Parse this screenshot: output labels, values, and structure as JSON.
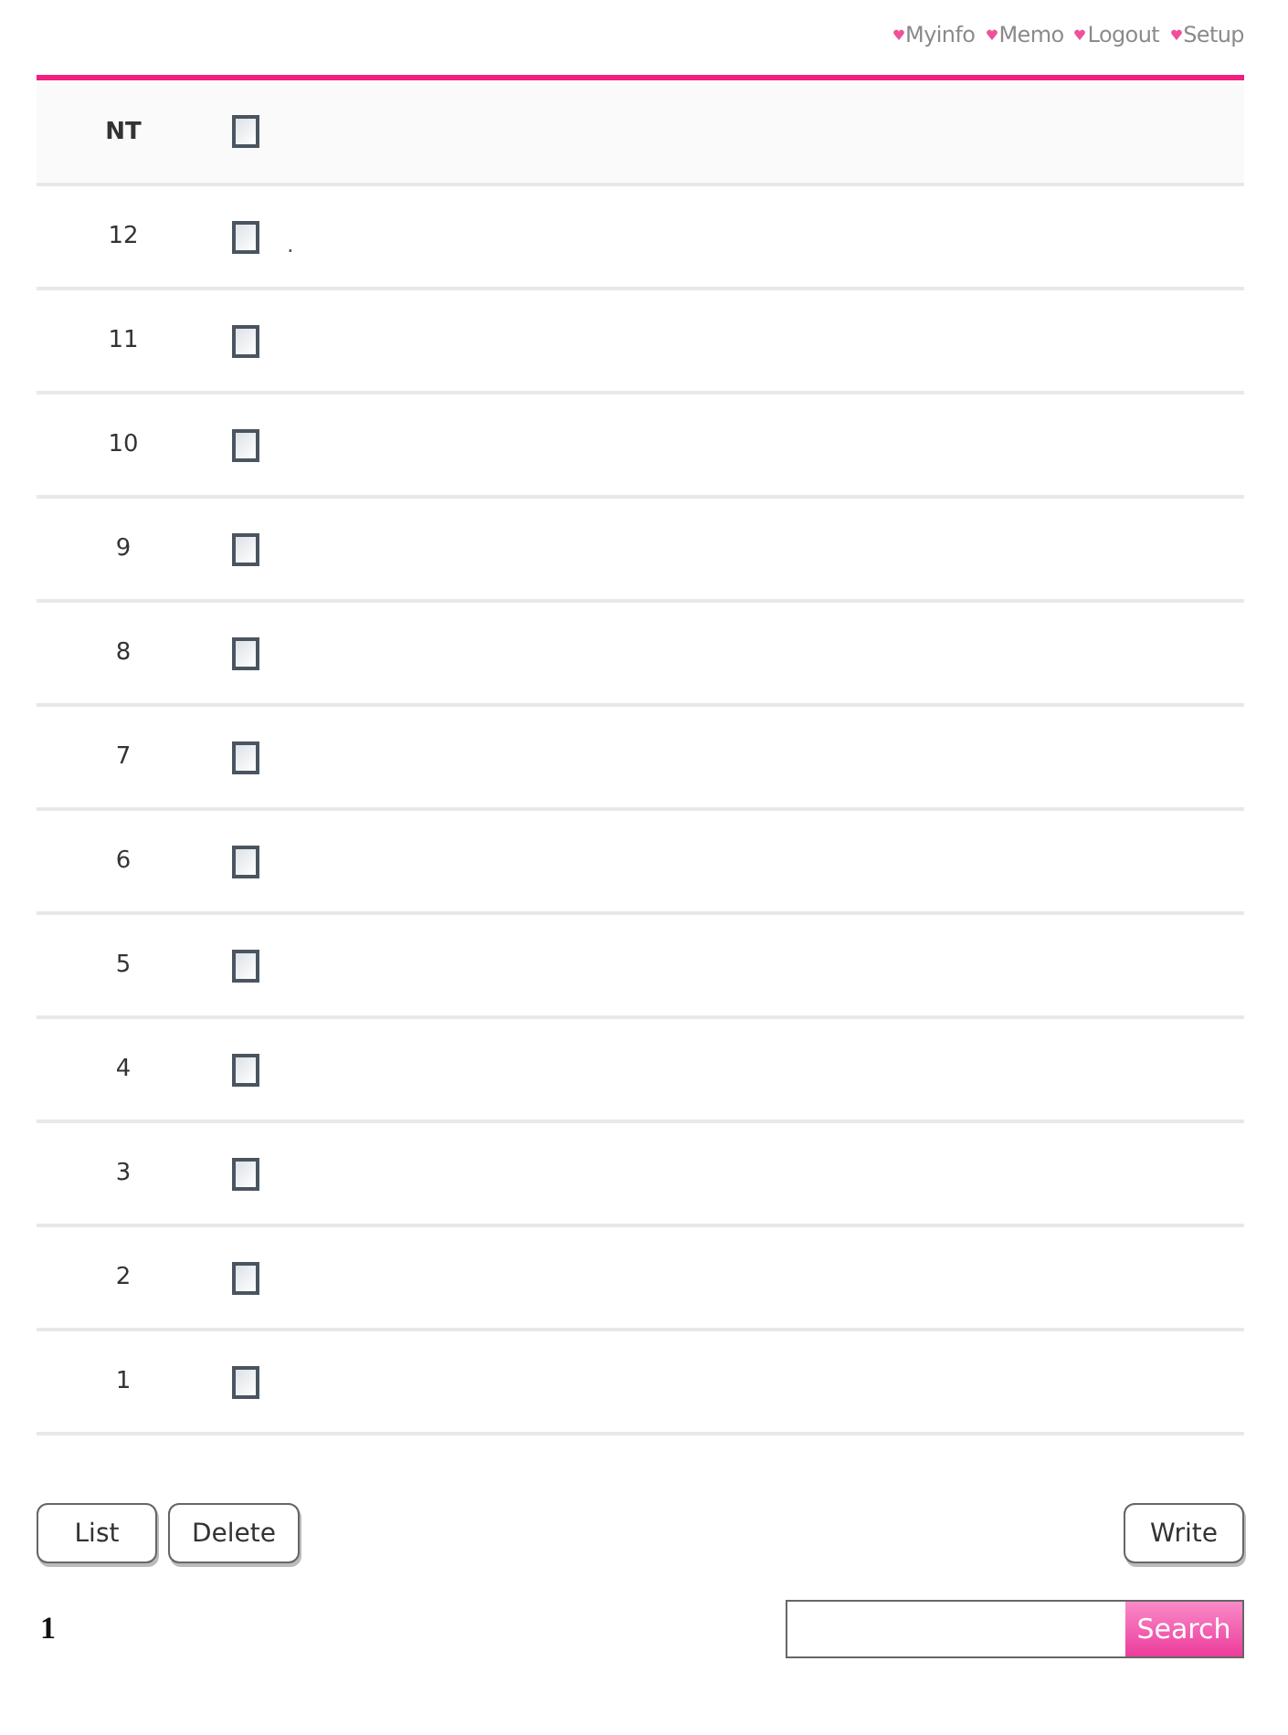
{
  "top_links": [
    {
      "label": "Myinfo"
    },
    {
      "label": "Memo"
    },
    {
      "label": "Logout"
    },
    {
      "label": "Setup"
    }
  ],
  "table": {
    "header": {
      "label": "NT",
      "checked": false
    },
    "rows": [
      {
        "number": "12",
        "checked": false,
        "title": "."
      },
      {
        "number": "11",
        "checked": false
      },
      {
        "number": "10",
        "checked": false
      },
      {
        "number": "9",
        "checked": false
      },
      {
        "number": "8",
        "checked": false
      },
      {
        "number": "7",
        "checked": false
      },
      {
        "number": "6",
        "checked": false
      },
      {
        "number": "5",
        "checked": false
      },
      {
        "number": "4",
        "checked": false
      },
      {
        "number": "3",
        "checked": false
      },
      {
        "number": "2",
        "checked": false
      },
      {
        "number": "1",
        "checked": false
      }
    ]
  },
  "buttons_left": [
    "List",
    "Delete"
  ],
  "buttons_right": [
    "Write"
  ],
  "pagination": [
    {
      "label": "1",
      "selected": true
    }
  ],
  "search": {
    "button": "Search"
  }
}
